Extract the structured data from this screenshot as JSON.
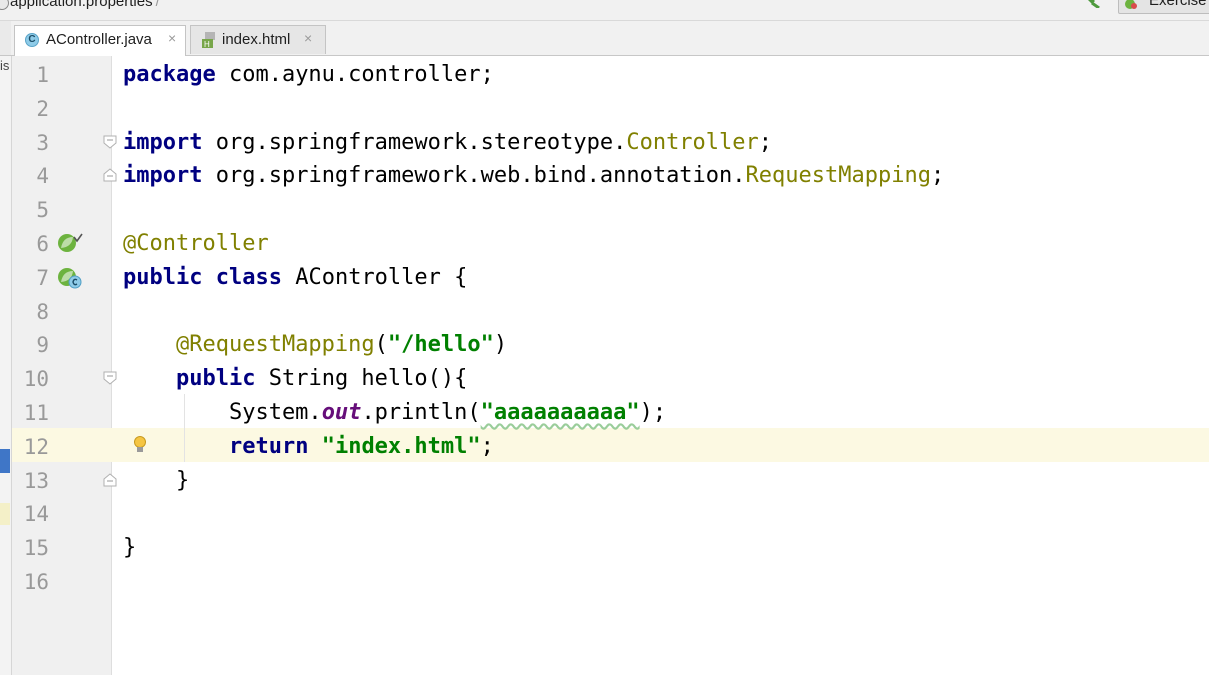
{
  "breadcrumb": {
    "file": "application.properties",
    "separator": "/"
  },
  "run_config": {
    "label": "Exercise",
    "icon": "spring-boot-run-icon"
  },
  "tabs": [
    {
      "label": "AController.java",
      "icon": "java-class-icon",
      "active": true,
      "close": "×"
    },
    {
      "label": "index.html",
      "icon": "html-file-icon",
      "active": false,
      "close": "×"
    }
  ],
  "side_label": "is",
  "colors": {
    "keyword": "#000080",
    "annotation": "#808000",
    "string": "#008000",
    "static_field": "#660e7a",
    "line_number": "#999999",
    "caret_line": "#fcf9e2"
  },
  "editor": {
    "caret_line": 12,
    "lines": [
      {
        "n": "1",
        "segments": [
          {
            "t": "package",
            "c": "kw"
          },
          {
            "t": " com.aynu.controller;"
          }
        ]
      },
      {
        "n": "2",
        "segments": []
      },
      {
        "n": "3",
        "segments": [
          {
            "t": "import",
            "c": "kw"
          },
          {
            "t": " org.springframework.stereotype."
          },
          {
            "t": "Controller",
            "c": "imp"
          },
          {
            "t": ";"
          }
        ],
        "fold": "open"
      },
      {
        "n": "4",
        "segments": [
          {
            "t": "import",
            "c": "kw"
          },
          {
            "t": " org.springframework.web.bind.annotation."
          },
          {
            "t": "RequestMapping",
            "c": "imp"
          },
          {
            "t": ";"
          }
        ],
        "fold": "close"
      },
      {
        "n": "5",
        "segments": []
      },
      {
        "n": "6",
        "segments": [
          {
            "t": "@Controller",
            "c": "ann"
          }
        ],
        "gutter_icon": "spring-bean-icon"
      },
      {
        "n": "7",
        "segments": [
          {
            "t": "public",
            "c": "kw"
          },
          {
            "t": " "
          },
          {
            "t": "class",
            "c": "kw"
          },
          {
            "t": " AController {"
          }
        ],
        "gutter_icon": "spring-class-icon"
      },
      {
        "n": "8",
        "segments": []
      },
      {
        "n": "9",
        "segments": [
          {
            "t": "    "
          },
          {
            "t": "@RequestMapping",
            "c": "ann"
          },
          {
            "t": "("
          },
          {
            "t": "\"/hello\"",
            "c": "str"
          },
          {
            "t": ")"
          }
        ]
      },
      {
        "n": "10",
        "segments": [
          {
            "t": "    "
          },
          {
            "t": "public",
            "c": "kw"
          },
          {
            "t": " String hello(){"
          }
        ],
        "fold": "open"
      },
      {
        "n": "11",
        "segments": [
          {
            "t": "        System."
          },
          {
            "t": "out",
            "c": "fld"
          },
          {
            "t": ".println("
          },
          {
            "t": "\"aaaaaaaaaa\"",
            "c": "str typo"
          },
          {
            "t": ");"
          }
        ]
      },
      {
        "n": "12",
        "segments": [
          {
            "t": "        "
          },
          {
            "t": "return",
            "c": "kw"
          },
          {
            "t": " "
          },
          {
            "t": "\"index.html\"",
            "c": "str"
          },
          {
            "t": ";"
          }
        ],
        "gutter_icon": "lightbulb-icon"
      },
      {
        "n": "13",
        "segments": [
          {
            "t": "    }"
          }
        ],
        "fold": "close"
      },
      {
        "n": "14",
        "segments": []
      },
      {
        "n": "15",
        "segments": [
          {
            "t": "}"
          }
        ]
      },
      {
        "n": "16",
        "segments": []
      }
    ]
  }
}
